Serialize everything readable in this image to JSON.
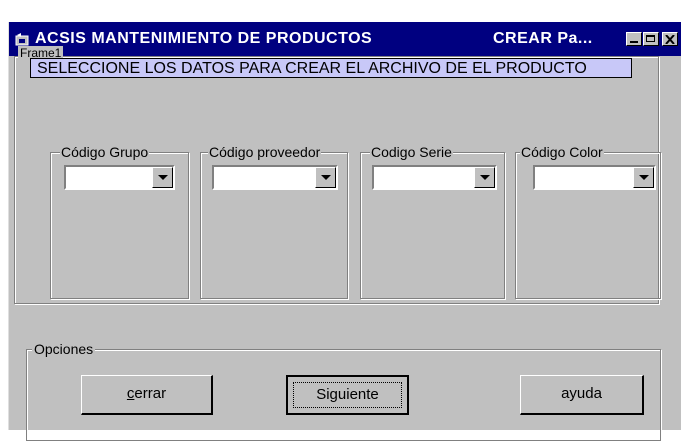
{
  "window": {
    "title": "ACSIS MANTENIMIENTO DE PRODUCTOS",
    "title_right": "CREAR Pa..."
  },
  "frame1": {
    "label": "Frame1",
    "instruction": "SELECCIONE LOS DATOS PARA CREAR EL ARCHIVO DE EL PRODUCTO"
  },
  "groups": [
    {
      "label": "Código Grupo"
    },
    {
      "label": "Código proveedor"
    },
    {
      "label": "Codigo Serie"
    },
    {
      "label": "Código Color"
    }
  ],
  "options": {
    "label": "Opciones",
    "buttons": {
      "cerrar_first": "c",
      "cerrar_rest": "errar",
      "siguiente": "Siguiente",
      "ayuda": "ayuda"
    }
  },
  "colors": {
    "title_bar": "#000080",
    "face": "#c0c0c0",
    "instruction_bg": "#c8c8f8"
  }
}
